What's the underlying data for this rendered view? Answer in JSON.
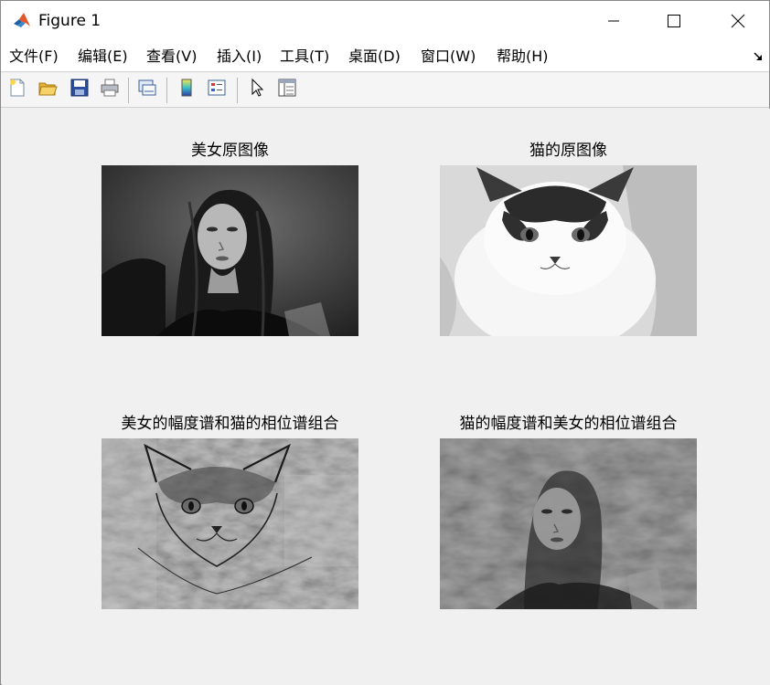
{
  "window": {
    "title": "Figure 1",
    "icon": "matlab-icon"
  },
  "window_controls": [
    "minimize-icon",
    "maximize-icon",
    "close-icon"
  ],
  "menubar": {
    "items": [
      "文件(F)",
      "编辑(E)",
      "查看(V)",
      "插入(I)",
      "工具(T)",
      "桌面(D)",
      "窗口(W)",
      "帮助(H)"
    ],
    "dock_icon": "dock-arrow-icon"
  },
  "toolbar": {
    "buttons": [
      "new-figure-icon",
      "open-file-icon",
      "save-icon",
      "print-icon",
      "link-plot-icon",
      "colorbar-icon",
      "legend-icon",
      "pointer-icon",
      "property-inspector-icon"
    ]
  },
  "plots": [
    {
      "title": "美女原图像",
      "content": "grayscale photo of a woman"
    },
    {
      "title": "猫的原图像",
      "content": "grayscale photo of a kitten"
    },
    {
      "title": "美女的幅度谱和猫的相位谱组合",
      "content": "reconstructed image resembling the kitten"
    },
    {
      "title": "猫的幅度谱和美女的相位谱组合",
      "content": "reconstructed image resembling the woman"
    }
  ]
}
